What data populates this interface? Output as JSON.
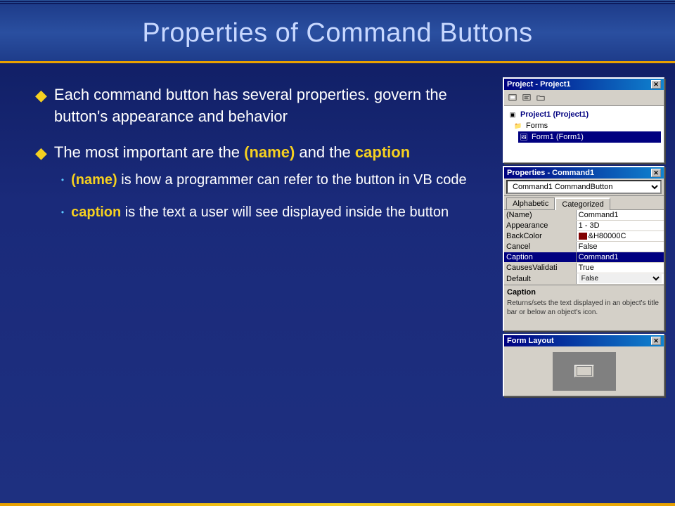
{
  "slide": {
    "title": "Properties of Command Buttons",
    "accent_color": "#e8a000",
    "background_color": "#1a237e"
  },
  "content": {
    "bullets": [
      {
        "text_parts": [
          {
            "text": "Each command button has several properties. govern the button's appearance and behavior",
            "highlight": null
          }
        ]
      },
      {
        "text_parts": [
          {
            "text": "The most important are the ",
            "highlight": null
          },
          {
            "text": "(name)",
            "highlight": "name"
          },
          {
            "text": " and the ",
            "highlight": null
          },
          {
            "text": "caption",
            "highlight": "caption"
          }
        ],
        "sub_bullets": [
          {
            "text_parts": [
              {
                "text": "(name)",
                "highlight": "name"
              },
              {
                "text": " is how a programmer can refer to the button in VB code",
                "highlight": null
              }
            ]
          },
          {
            "text_parts": [
              {
                "text": "caption",
                "highlight": "caption"
              },
              {
                "text": " is the text a user will see displayed inside the button",
                "highlight": null
              }
            ]
          }
        ]
      }
    ]
  },
  "project_window": {
    "title": "Project - Project1",
    "toolbar_buttons": [
      "folder-open-icon",
      "folder-closed-icon",
      "code-icon"
    ],
    "tree": [
      {
        "label": "Project1 (Project1)",
        "level": 0,
        "icon": "project-icon",
        "expanded": true
      },
      {
        "label": "Forms",
        "level": 1,
        "icon": "folder-icon",
        "expanded": true
      },
      {
        "label": "Form1 (Form1)",
        "level": 2,
        "icon": "form-icon",
        "selected": true
      }
    ]
  },
  "properties_window": {
    "title": "Properties - Command1",
    "combo_value": "Command1 CommandButton",
    "tabs": [
      "Alphabetic",
      "Categorized"
    ],
    "active_tab": "Categorized",
    "rows": [
      {
        "property": "(Name)",
        "value": "Command1"
      },
      {
        "property": "Appearance",
        "value": "1 - 3D"
      },
      {
        "property": "BackColor",
        "value": "&H80000C",
        "has_swatch": true
      },
      {
        "property": "Cancel",
        "value": "False"
      },
      {
        "property": "Caption",
        "value": "Command1",
        "selected": true
      },
      {
        "property": "CausesValidati",
        "value": "True"
      },
      {
        "property": "Default",
        "value": "False"
      }
    ],
    "description": {
      "title": "Caption",
      "text": "Returns/sets the text displayed in an object's title bar or below an object's icon."
    }
  },
  "form_layout_window": {
    "title": "Form Layout"
  },
  "icons": {
    "bullet_diamond": "◆",
    "sub_bullet_dot": "•",
    "close_x": "✕",
    "folder_open": "📂",
    "folder_closed": "📁",
    "project": "📊",
    "form": "🖼",
    "vb_icon": "VB"
  }
}
